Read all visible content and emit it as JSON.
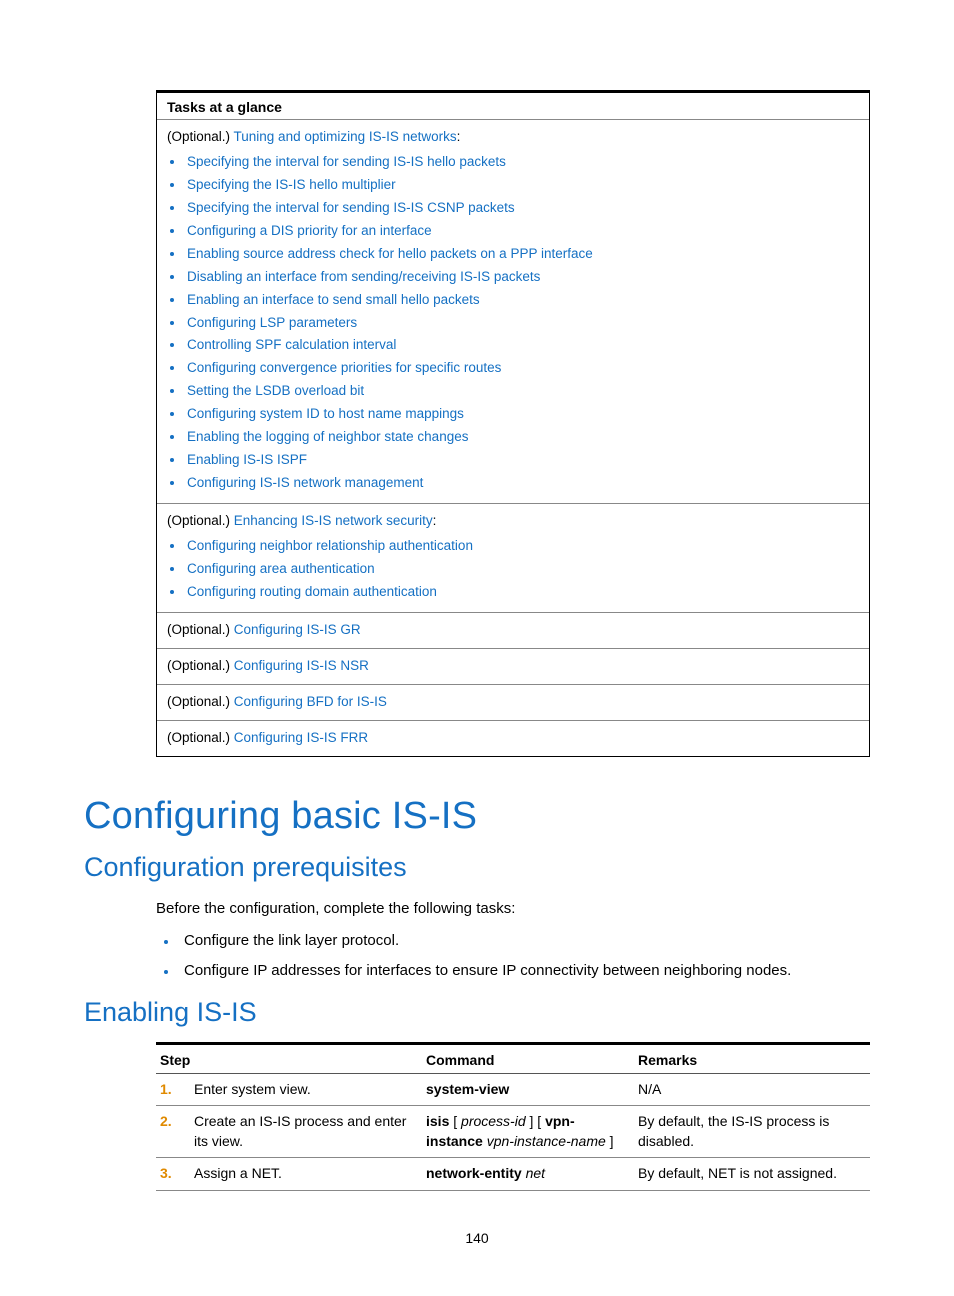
{
  "tasks_header": "Tasks at a glance",
  "optional_label": "(Optional.) ",
  "colon": ":",
  "section1": {
    "title_link": "Tuning and optimizing IS-IS networks",
    "items": [
      "Specifying the interval for sending IS-IS hello packets",
      "Specifying the IS-IS hello multiplier",
      "Specifying the interval for sending IS-IS CSNP packets",
      "Configuring a DIS priority for an interface",
      "Enabling source address check for hello packets on a PPP interface",
      "Disabling an interface from sending/receiving IS-IS packets",
      "Enabling an interface to send small hello packets",
      "Configuring LSP parameters",
      "Controlling SPF calculation interval",
      "Configuring convergence priorities for specific routes",
      "Setting the LSDB overload bit",
      "Configuring system ID to host name mappings",
      "Enabling the logging of neighbor state changes",
      "Enabling IS-IS ISPF",
      "Configuring IS-IS network management"
    ]
  },
  "section2": {
    "title_link": "Enhancing IS-IS network security",
    "items": [
      "Configuring neighbor relationship authentication",
      "Configuring area authentication",
      "Configuring routing domain authentication"
    ]
  },
  "single_rows": [
    "Configuring IS-IS GR",
    "Configuring IS-IS NSR",
    "Configuring BFD for IS-IS",
    "Configuring IS-IS FRR"
  ],
  "h1": "Configuring basic IS-IS",
  "h2a": "Configuration prerequisites",
  "prereq_intro": "Before the configuration, complete the following tasks:",
  "prereq_items": [
    "Configure the link layer protocol.",
    "Configure IP addresses for interfaces to ensure IP connectivity between neighboring nodes."
  ],
  "h2b": "Enabling IS-IS",
  "table": {
    "headers": [
      "Step",
      "Command",
      "Remarks"
    ],
    "rows": [
      {
        "num": "1.",
        "step": "Enter system view.",
        "cmd_html": "<b>system-view</b>",
        "remarks": "N/A"
      },
      {
        "num": "2.",
        "step": "Create an IS-IS process and enter its view.",
        "cmd_html": "<b>isis</b> [ <i>process-id</i> ] [ <b>vpn-instance</b> <i>vpn-instance-name</i> ]",
        "remarks": "By default, the IS-IS process is disabled."
      },
      {
        "num": "3.",
        "step": "Assign a NET.",
        "cmd_html": "<b>network-entity</b> <i>net</i>",
        "remarks": "By default, NET is not assigned."
      }
    ]
  },
  "page_number": "140"
}
